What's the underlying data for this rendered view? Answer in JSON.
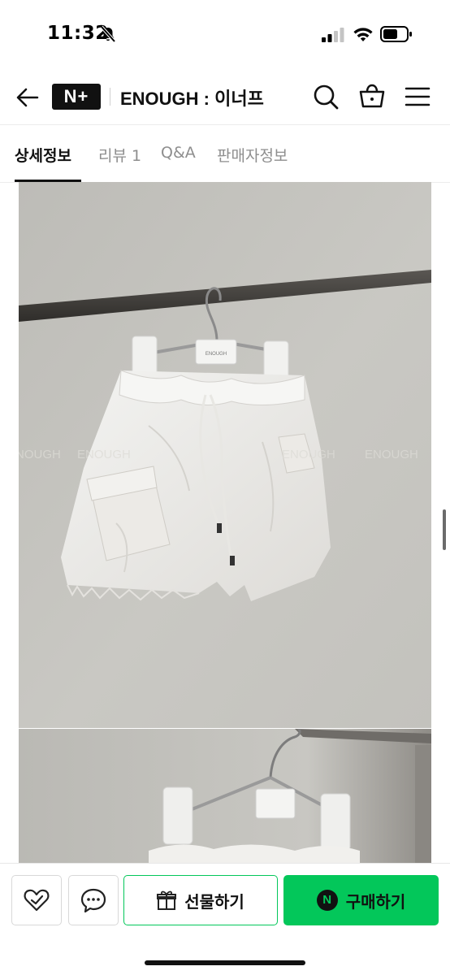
{
  "status_bar": {
    "time": "11:32",
    "icons": [
      "bell-slash-icon",
      "signal-icon",
      "wifi-icon",
      "battery-icon"
    ]
  },
  "nav": {
    "logo_text": "N+",
    "store_name": "ENOUGH : 이너프",
    "icons": [
      "back-arrow-icon",
      "search-icon",
      "shopping-bag-icon",
      "menu-icon"
    ]
  },
  "tabs": [
    {
      "label": "상세정보",
      "active": true
    },
    {
      "label": "리뷰 1",
      "active": false
    },
    {
      "label": "Q&A",
      "active": false
    },
    {
      "label": "판매자정보",
      "active": false
    }
  ],
  "product_images": {
    "watermark": "ENOUGH",
    "hanger_tag": "ENOUGH"
  },
  "bottom_bar": {
    "gift_label": "선물하기",
    "buy_label": "구매하기",
    "npay_mark": "N",
    "icons": [
      "heart-check-icon",
      "chat-bubble-icon",
      "gift-icon",
      "npay-icon"
    ],
    "colors": {
      "accent": "#03c75a"
    }
  }
}
